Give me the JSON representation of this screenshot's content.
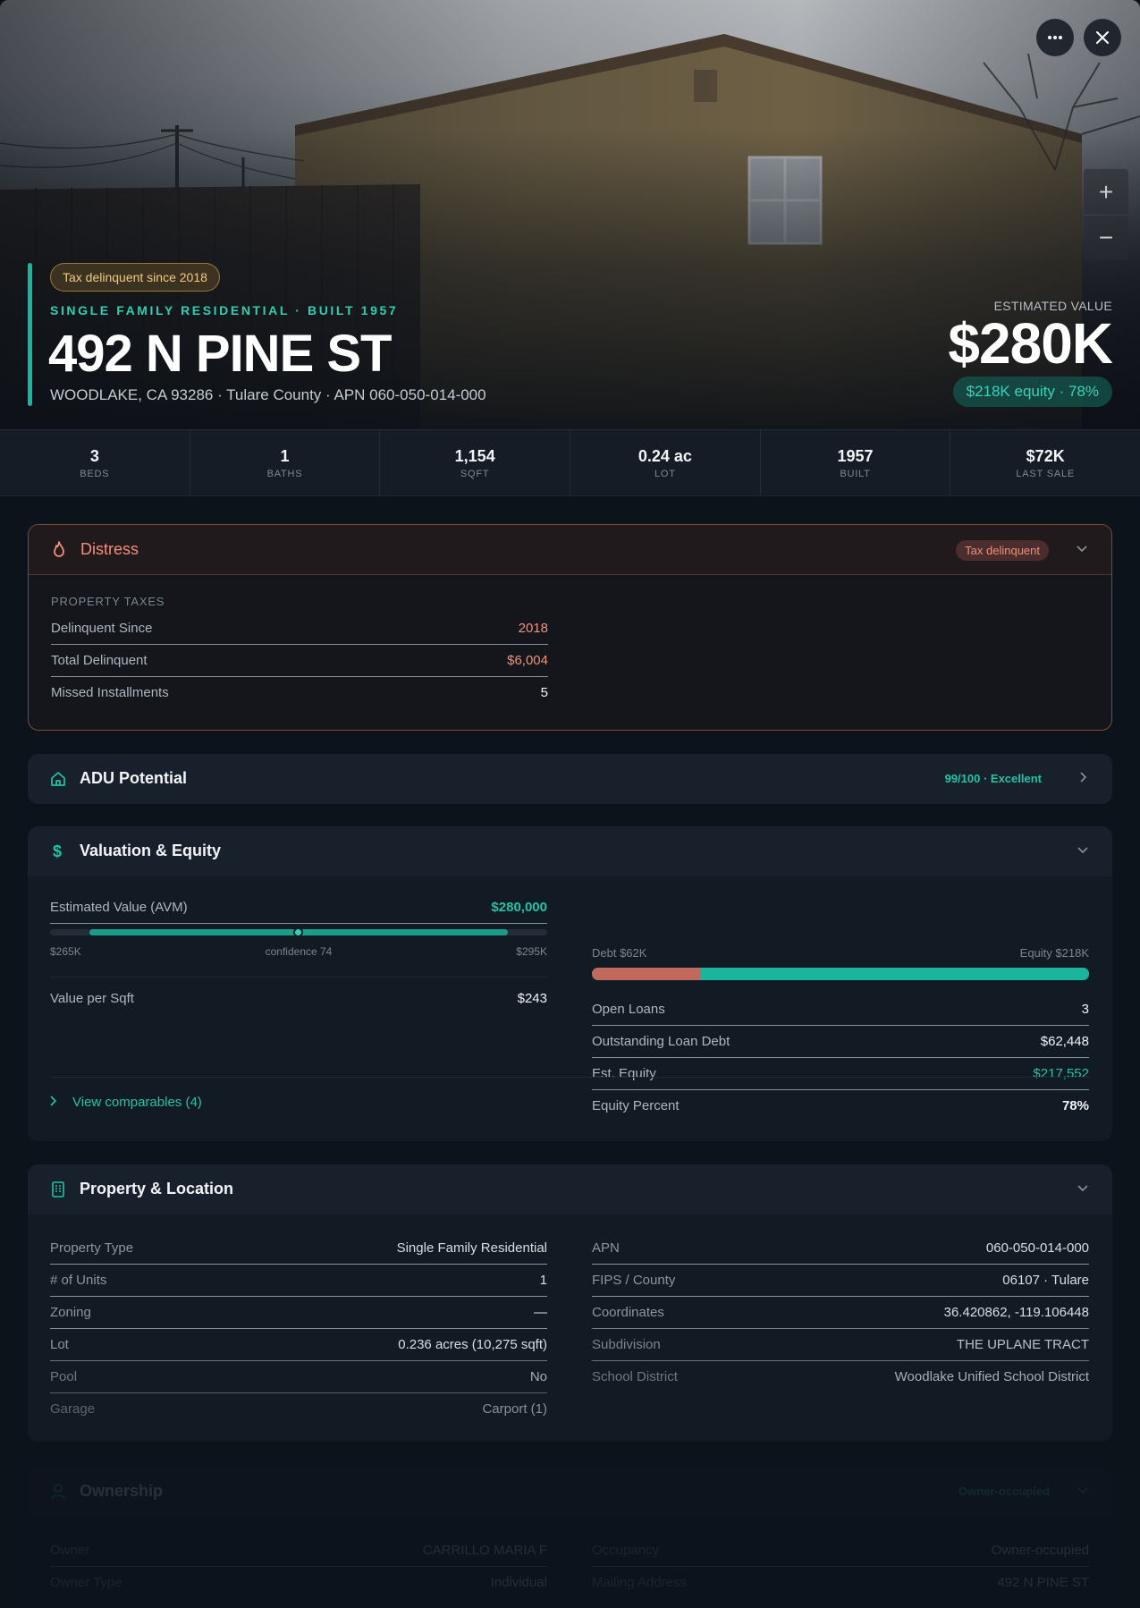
{
  "hero": {
    "tag": "Tax delinquent since 2018",
    "kicker": "SINGLE FAMILY RESIDENTIAL · BUILT 1957",
    "address": "492 N PINE ST",
    "subline": "WOODLAKE, CA 93286 · Tulare County · APN 060-050-014-000",
    "estimated_value_label": "ESTIMATED VALUE",
    "estimated_value": "$280K",
    "equity_pill": "$218K equity · 78%",
    "more_icon": "more-horizontal-icon",
    "close_icon": "close-icon",
    "zoom_in": "+",
    "zoom_out": "−"
  },
  "stats": [
    {
      "value": "3",
      "label": "BEDS"
    },
    {
      "value": "1",
      "label": "BATHS"
    },
    {
      "value": "1,154",
      "label": "SQFT"
    },
    {
      "value": "0.24 ac",
      "label": "LOT"
    },
    {
      "value": "1957",
      "label": "BUILT"
    },
    {
      "value": "$72K",
      "label": "LAST SALE"
    }
  ],
  "distress": {
    "title": "Distress",
    "badge": "Tax delinquent",
    "section_label": "PROPERTY TAXES",
    "rows": [
      {
        "label": "Delinquent Since",
        "value": "2018"
      },
      {
        "label": "Total Delinquent",
        "value": "$6,004"
      },
      {
        "label": "Missed Installments",
        "value": "5"
      }
    ]
  },
  "adu": {
    "title": "ADU Potential",
    "score": "99/100 · Excellent"
  },
  "valuation": {
    "title": "Valuation & Equity",
    "avm_label": "Estimated Value (AVM)",
    "avm_value": "$280,000",
    "range_low": "$265K",
    "confidence": "confidence 74",
    "range_high": "$295K",
    "per_sqft_label": "Value per Sqft",
    "per_sqft_value": "$243",
    "debt_label": "Debt $62K",
    "equity_label": "Equity $218K",
    "debt_fraction": 0.22,
    "equity_fraction": 0.78,
    "rows": [
      {
        "label": "Open Loans",
        "value": "3"
      },
      {
        "label": "Outstanding Loan Debt",
        "value": "$62,448"
      },
      {
        "label": "Est. Equity",
        "value": "$217,552"
      },
      {
        "label": "Equity Percent",
        "value": "78%"
      }
    ],
    "view_comps": "View comparables (4)"
  },
  "property": {
    "title": "Property & Location",
    "left": [
      {
        "label": "Property Type",
        "value": "Single Family Residential"
      },
      {
        "label": "# of Units",
        "value": "1"
      },
      {
        "label": "Zoning",
        "value": "—"
      },
      {
        "label": "Lot",
        "value": "0.236 acres (10,275 sqft)"
      },
      {
        "label": "Pool",
        "value": "No"
      },
      {
        "label": "Garage",
        "value": "Carport (1)"
      }
    ],
    "right": [
      {
        "label": "APN",
        "value": "060-050-014-000"
      },
      {
        "label": "FIPS / County",
        "value": "06107 · Tulare"
      },
      {
        "label": "Coordinates",
        "value": "36.420862, -119.106448"
      },
      {
        "label": "Subdivision",
        "value": "THE UPLANE TRACT"
      },
      {
        "label": "School District",
        "value": "Woodlake Unified School District"
      }
    ]
  },
  "ownership": {
    "title": "Ownership",
    "badge": "Owner-occupied",
    "left": [
      {
        "label": "Owner",
        "value": "CARRILLO MARIA F"
      },
      {
        "label": "Owner Type",
        "value": "Individual"
      }
    ],
    "right": [
      {
        "label": "Occupancy",
        "value": "Owner-occupied"
      },
      {
        "label": "Mailing Address",
        "value": "492 N PINE ST"
      }
    ]
  },
  "colors": {
    "accent": "#22c4a7",
    "danger": "#f0917c",
    "warning": "#f0c986",
    "background": "#0d131b"
  }
}
